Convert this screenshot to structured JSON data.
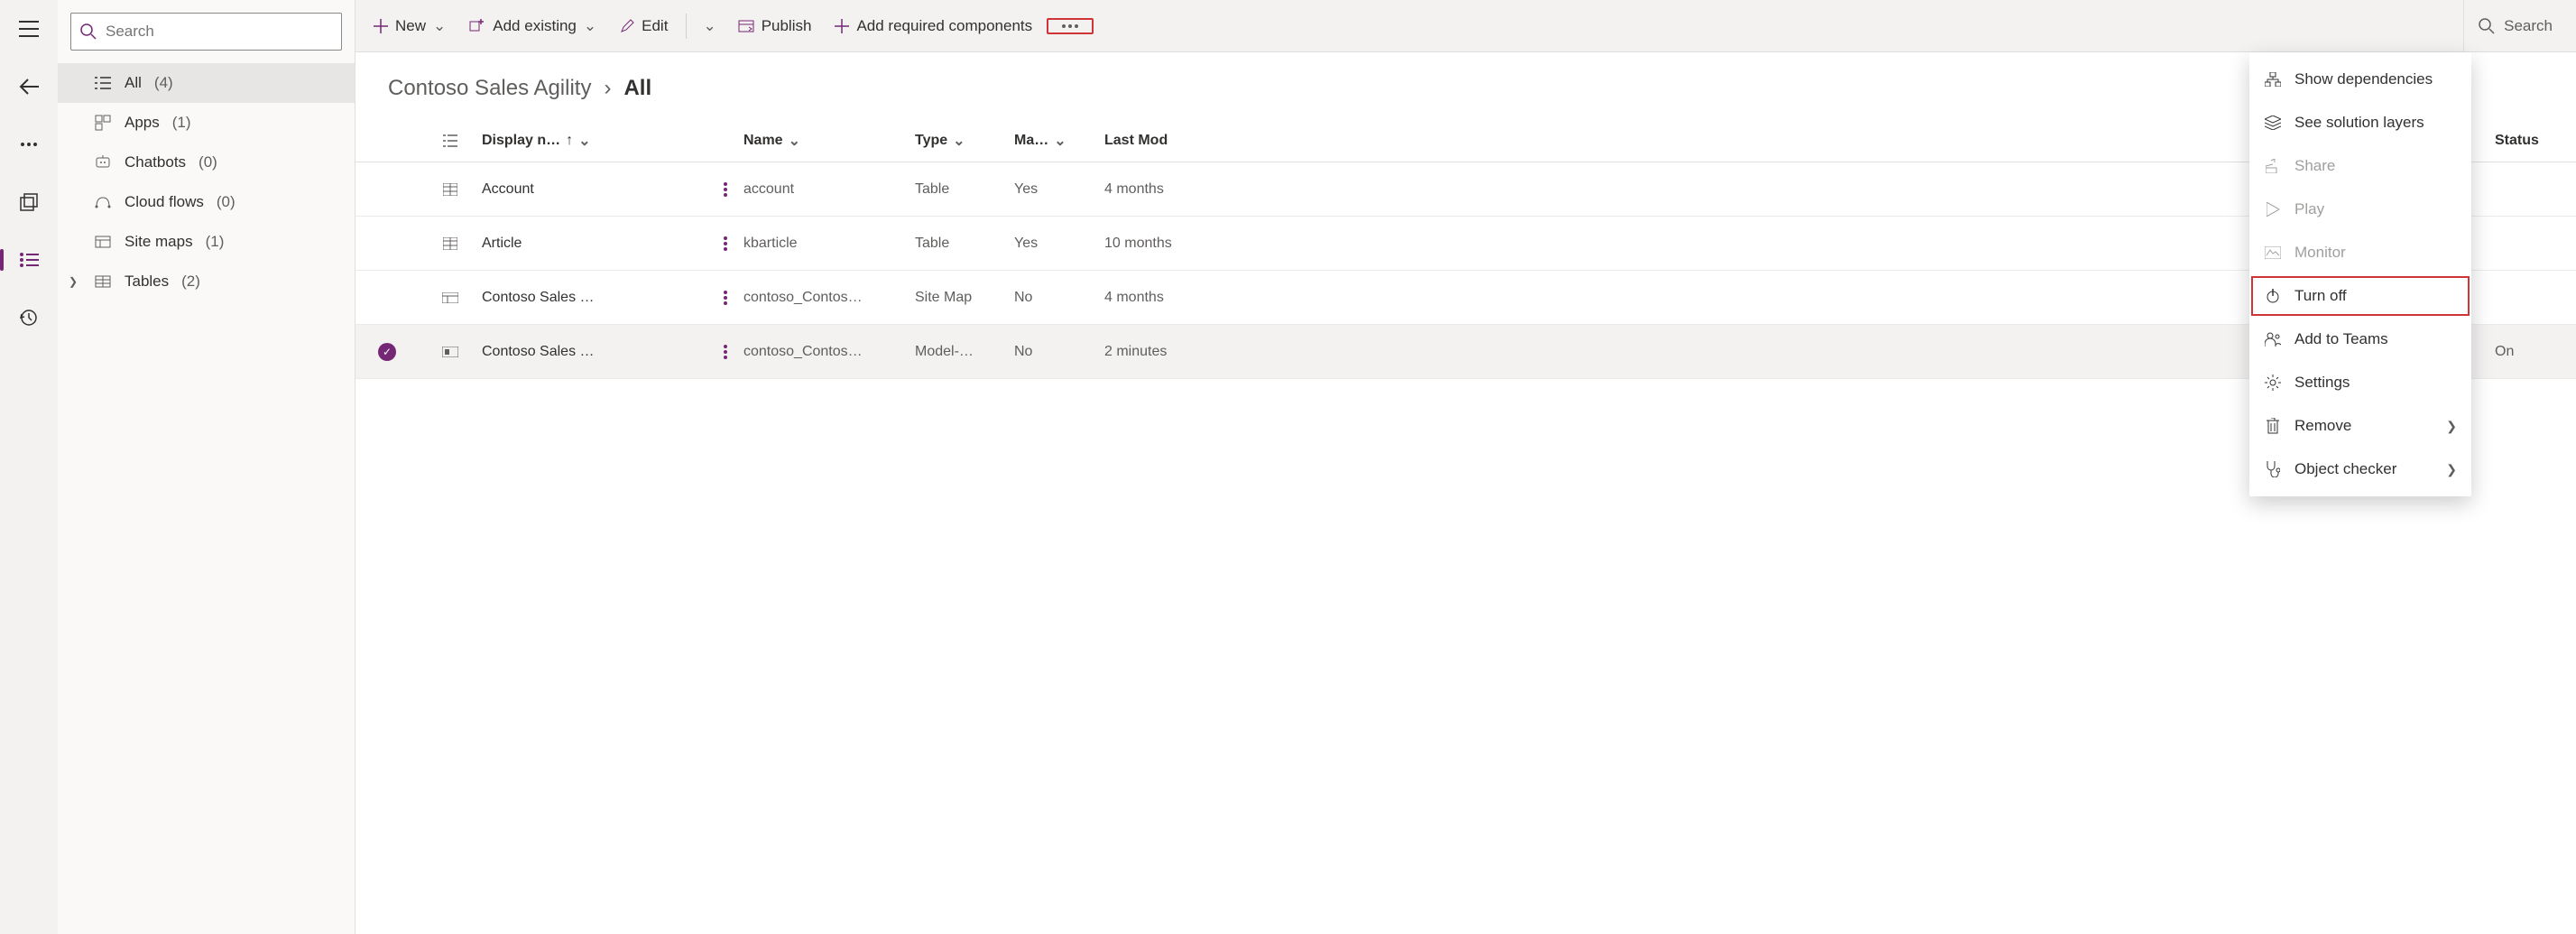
{
  "search": {
    "placeholder": "Search"
  },
  "sidebar": {
    "items": [
      {
        "label": "All",
        "count": "(4)"
      },
      {
        "label": "Apps",
        "count": "(1)"
      },
      {
        "label": "Chatbots",
        "count": "(0)"
      },
      {
        "label": "Cloud flows",
        "count": "(0)"
      },
      {
        "label": "Site maps",
        "count": "(1)"
      },
      {
        "label": "Tables",
        "count": "(2)"
      }
    ]
  },
  "commands": {
    "new": "New",
    "add_existing": "Add existing",
    "edit": "Edit",
    "publish": "Publish",
    "add_required": "Add required components",
    "search_right": "Search"
  },
  "breadcrumb": {
    "root": "Contoso Sales Agility",
    "current": "All"
  },
  "table": {
    "headers": {
      "display_name": "Display n…",
      "name": "Name",
      "type": "Type",
      "managed": "Ma…",
      "last_modified": "Last Mod",
      "status": "Status"
    },
    "rows": [
      {
        "display": "Account",
        "name": "account",
        "type": "Table",
        "managed": "Yes",
        "modified": "4 months",
        "status": "",
        "icon": "table",
        "selected": false
      },
      {
        "display": "Article",
        "name": "kbarticle",
        "type": "Table",
        "managed": "Yes",
        "modified": "10 months",
        "status": "",
        "icon": "table",
        "selected": false
      },
      {
        "display": "Contoso Sales …",
        "name": "contoso_Contos…",
        "type": "Site Map",
        "managed": "No",
        "modified": "4 months",
        "status": "",
        "icon": "sitemap",
        "selected": false
      },
      {
        "display": "Contoso Sales …",
        "name": "contoso_Contos…",
        "type": "Model-…",
        "managed": "No",
        "modified": "2 minutes",
        "status": "On",
        "icon": "app",
        "selected": true
      }
    ]
  },
  "menu": {
    "items": [
      {
        "label": "Show dependencies",
        "icon": "deps",
        "disabled": false
      },
      {
        "label": "See solution layers",
        "icon": "layers",
        "disabled": false
      },
      {
        "label": "Share",
        "icon": "share",
        "disabled": true
      },
      {
        "label": "Play",
        "icon": "play",
        "disabled": true
      },
      {
        "label": "Monitor",
        "icon": "monitor",
        "disabled": true
      },
      {
        "label": "Turn off",
        "icon": "power",
        "disabled": false,
        "highlight": true
      },
      {
        "label": "Add to Teams",
        "icon": "teams",
        "disabled": false
      },
      {
        "label": "Settings",
        "icon": "gear",
        "disabled": false
      },
      {
        "label": "Remove",
        "icon": "trash",
        "disabled": false,
        "chevron": true
      },
      {
        "label": "Object checker",
        "icon": "steth",
        "disabled": false,
        "chevron": true
      }
    ]
  }
}
